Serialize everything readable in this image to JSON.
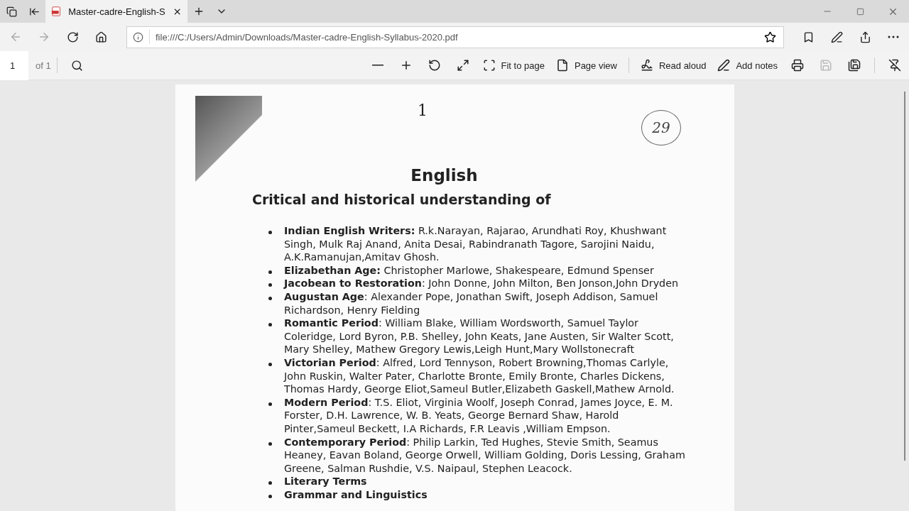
{
  "tab": {
    "title": "Master-cadre-English-S",
    "selected": true
  },
  "address": {
    "url": "file:///C:/Users/Admin/Downloads/Master-cadre-English-Syllabus-2020.pdf"
  },
  "pdf_toolbar": {
    "page": "1",
    "page_count": "of 1",
    "buttons": [
      {
        "kind": "zoom-out"
      },
      {
        "kind": "zoom-in"
      },
      {
        "kind": "rotate"
      },
      {
        "kind": "fullscreen"
      },
      {
        "kind": "fit",
        "label": "Fit to page"
      },
      {
        "kind": "pageview",
        "label": "Page view"
      },
      {
        "kind": "separator"
      },
      {
        "kind": "read",
        "label": "Read aloud"
      },
      {
        "kind": "notes",
        "label": "Add notes"
      },
      {
        "kind": "print"
      },
      {
        "kind": "save",
        "disabled": true
      },
      {
        "kind": "saveas"
      },
      {
        "kind": "separator"
      },
      {
        "kind": "pin"
      }
    ]
  },
  "document": {
    "page_mark": "1",
    "annotation": "29",
    "title": "English",
    "subtitle": "Critical and historical understanding of",
    "items": [
      "**Indian English Writers:** R.k.Narayan, Rajarao, Arundhati Roy, Khushwant Singh, Mulk Raj Anand, Anita Desai, Rabindranath Tagore, Sarojini Naidu, A.K.Ramanujan,Amitav Ghosh.",
      "**Elizabethan Age:** Christopher Marlowe, Shakespeare, Edmund Spenser",
      "**Jacobean to Restoration**: John Donne, John Milton, Ben Jonson,John Dryden",
      "**Augustan Age**: Alexander Pope, Jonathan Swift, Joseph Addison, Samuel Richardson, Henry Fielding",
      "**Romantic Period**: William Blake, William Wordsworth, Samuel Taylor Coleridge, Lord Byron, P.B. Shelley, John Keats, Jane Austen, Sir Walter Scott, Mary Shelley, Mathew Gregory Lewis,Leigh Hunt,Mary Wollstonecraft",
      "**Victorian Period**: Alfred, Lord Tennyson, Robert Browning,Thomas Carlyle, John Ruskin, Walter Pater, Charlotte Bronte, Emily Bronte, Charles Dickens, Thomas Hardy, George Eliot,Sameul Butler,Elizabeth Gaskell,Mathew Arnold.",
      "**Modern Period**: T.S. Eliot, Virginia Woolf, Joseph Conrad, James Joyce, E. M. Forster, D.H. Lawrence, W. B. Yeats, George Bernard Shaw, Harold Pinter,Sameul Beckett, I.A Richards, F.R Leavis ,William Empson.",
      "**Contemporary Period**: Philip Larkin, Ted Hughes, Stevie Smith, Seamus Heaney, Eavan Boland, George Orwell, William Golding, Doris Lessing, Graham Greene, Salman Rushdie, V.S. Naipaul, Stephen Leacock.",
      "**Literary Terms**",
      "**Grammar and Linguistics**"
    ]
  }
}
